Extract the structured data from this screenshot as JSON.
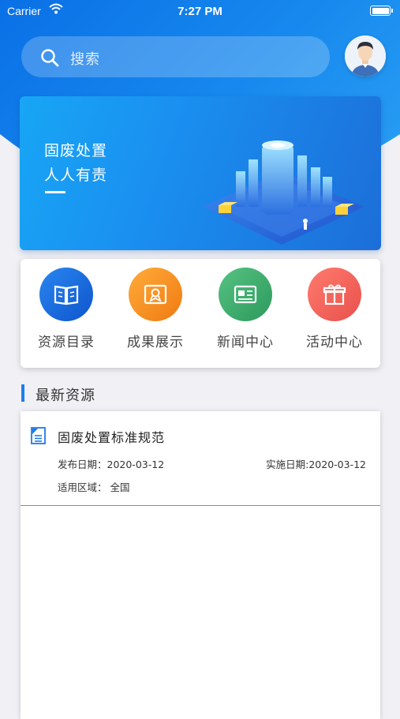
{
  "status_bar": {
    "carrier": "Carrier",
    "time": "7:27 PM"
  },
  "search": {
    "placeholder": "搜索"
  },
  "banner": {
    "line1": "固废处置",
    "line2": "人人有责"
  },
  "quick_links": [
    {
      "label": "资源目录",
      "icon": "book-icon",
      "color": "#1565d8"
    },
    {
      "label": "成果展示",
      "icon": "certificate-icon",
      "color": "#f08a1c"
    },
    {
      "label": "新闻中心",
      "icon": "newspaper-icon",
      "color": "#3aa66a"
    },
    {
      "label": "活动中心",
      "icon": "gift-icon",
      "color": "#f0605a"
    }
  ],
  "section": {
    "title": "最新资源"
  },
  "resources": [
    {
      "title": "固废处置标准规范",
      "publish_date": "发布日期：2020-03-12",
      "effective_date": "实施日期:2020-03-12",
      "region": "适用区域：  全国"
    }
  ],
  "colors": {
    "accent": "#1b7ff0",
    "header_gradient_start": "#0a70e6",
    "header_gradient_end": "#2aa0f4"
  }
}
